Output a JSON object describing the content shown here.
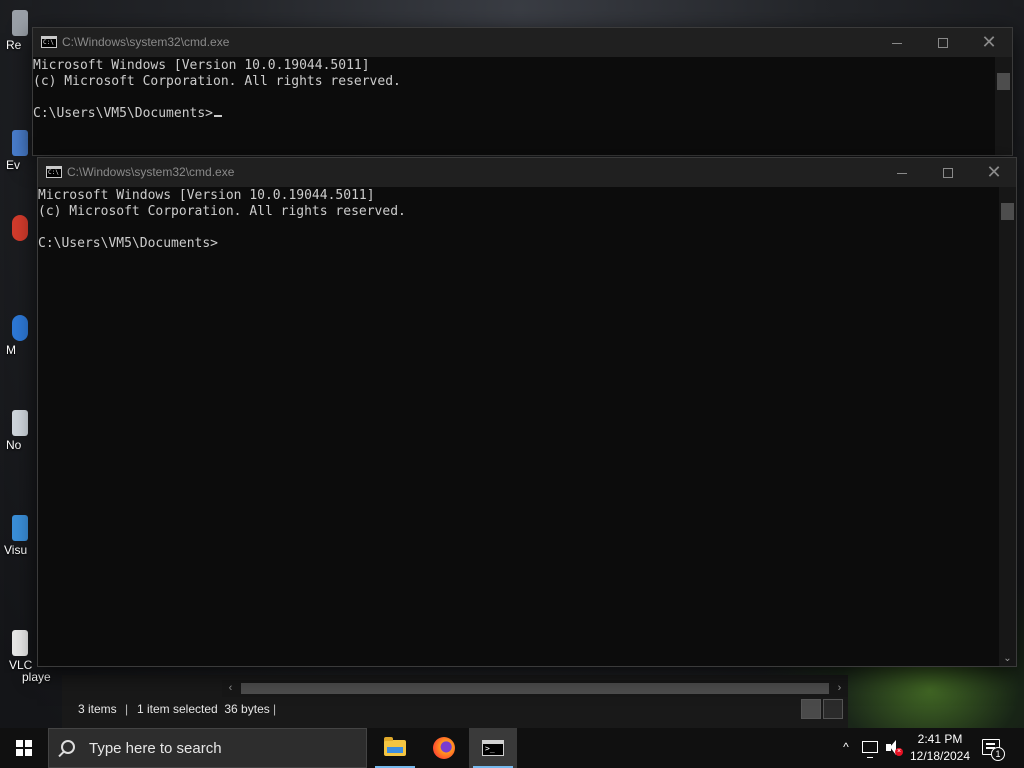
{
  "desktop": {
    "icons": [
      {
        "label": "Re",
        "color": "#9aa0a8"
      },
      {
        "label": "Ev",
        "color": "#4a7fcf"
      },
      {
        "label": "",
        "color": "#d33b2c"
      },
      {
        "label": "M",
        "color": "#2d78d6"
      },
      {
        "label": "No",
        "color": "#cfd6dd"
      },
      {
        "label": "Visu",
        "color": "#3a8fd9"
      },
      {
        "label": "VLC",
        "color": "#e8e8e8"
      },
      {
        "label": "playe",
        "color": ""
      }
    ]
  },
  "cmd_back": {
    "title": "C:\\Windows\\system32\\cmd.exe",
    "lines": [
      "Microsoft Windows [Version 10.0.19044.5011]",
      "(c) Microsoft Corporation. All rights reserved.",
      "",
      "C:\\Users\\VM5\\Documents>"
    ]
  },
  "cmd_front": {
    "title": "C:\\Windows\\system32\\cmd.exe",
    "lines": [
      "Microsoft Windows [Version 10.0.19044.5011]",
      "(c) Microsoft Corporation. All rights reserved.",
      "",
      "C:\\Users\\VM5\\Documents>"
    ]
  },
  "window_controls": {
    "minimize_icon": "minimize-icon",
    "maximize_icon": "maximize-icon",
    "close_symbol": "✕"
  },
  "explorer": {
    "status_items": "3 items",
    "status_selected": "1 item selected  36 bytes",
    "separator": "|",
    "scroll_left": "‹",
    "scroll_right": "›"
  },
  "taskbar": {
    "search_placeholder": "Type here to search",
    "apps": [
      {
        "name": "File Explorer",
        "icon": "folder-icon"
      },
      {
        "name": "Firefox",
        "icon": "firefox-icon"
      },
      {
        "name": "Command Prompt",
        "icon": "terminal-icon",
        "active": true
      }
    ],
    "tray_chevron": "^",
    "time": "2:41 PM",
    "date": "12/18/2024",
    "notification_count": "1"
  },
  "colors": {
    "terminal_bg": "#0c0c0c",
    "terminal_text": "#cccccc",
    "titlebar_bg": "#202020",
    "taskbar_bg": "#101010",
    "active_underline": "#76b9ed"
  }
}
